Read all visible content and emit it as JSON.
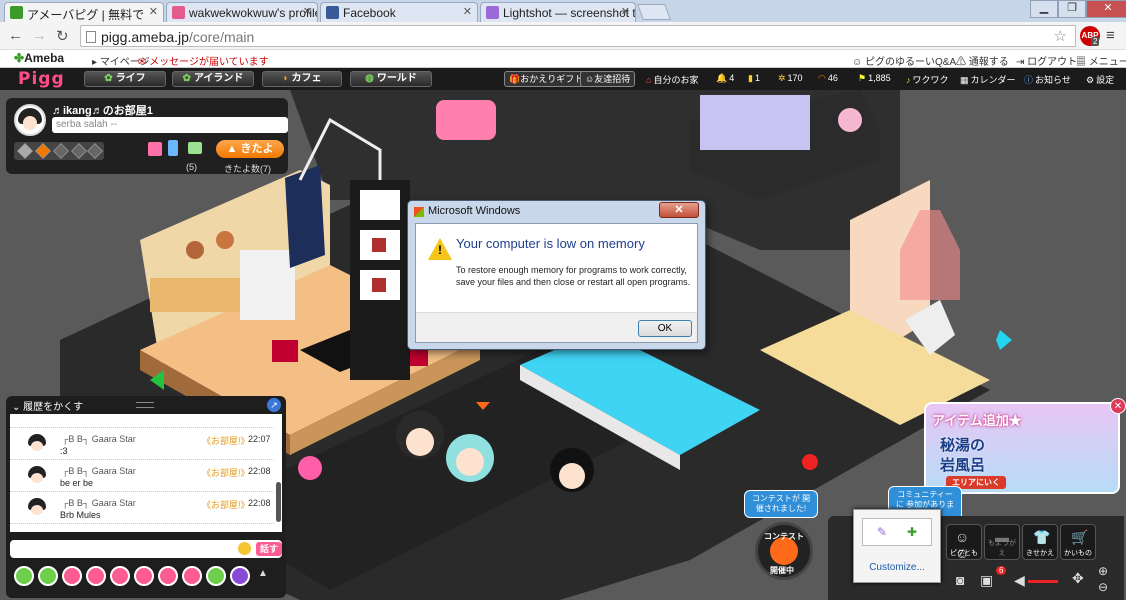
{
  "browser": {
    "tabs": [
      {
        "label": "アメーバピグ | 無料で",
        "favicon": "#3a9a2a"
      },
      {
        "label": "wakwekwokwuw's profile",
        "favicon": "#e55a8c"
      },
      {
        "label": "Facebook",
        "favicon": "#3b5998"
      },
      {
        "label": "Lightshot — screenshot to",
        "favicon": "#9c6ad8"
      }
    ],
    "url_host": "pigg.ameba.jp",
    "url_path": "/core/main",
    "abp_badge": "ABP",
    "abp_count": "2"
  },
  "ameba_bar": {
    "logo": "Ameba",
    "mypage": "マイページ",
    "messages": "メッセージが届いています",
    "help": "ピグのゆるーいQ&A",
    "report": "通報する",
    "logout": "ログアウト",
    "menu": "メニュー"
  },
  "pigg_header": {
    "logo": "Pigg",
    "nav": [
      "ライフ",
      "アイランド",
      "カフェ",
      "ワールド"
    ],
    "welcome_gift": "おかえりギフト",
    "invite": "友達招待",
    "home": "自分のお家",
    "bell_count": "4",
    "ticket_count": "1",
    "coin_count": "170",
    "rainbow_count": "46",
    "flag_count": "1,885",
    "wakuwaku": "ワクワク",
    "calendar": "カレンダー",
    "notice": "お知らせ",
    "settings": "設定"
  },
  "room_panel": {
    "title": "♬ikang♬のお部屋1",
    "status_placeholder": "serba salah --",
    "gift_count": "(5)",
    "kitayo_label": "きたよ",
    "kitayo_count": "きたよ数(7)"
  },
  "chat": {
    "hide_label": "履歴をかくす",
    "messages": [
      {
        "name": "┌B B┐ Gaara Star",
        "room": "《お部屋!》",
        "time": "22:07",
        "text": ":3"
      },
      {
        "name": "┌B B┐ Gaara Star",
        "room": "《お部屋!》",
        "time": "22:08",
        "text": "be er be"
      },
      {
        "name": "┌B B┐ Gaara Star",
        "room": "《お部屋!》",
        "time": "22:08",
        "text": "Brb Mules"
      }
    ],
    "say_label": "話す"
  },
  "dialog": {
    "title": "Microsoft Windows",
    "close_label": "✕",
    "heading": "Your computer is low on memory",
    "body": "To restore enough memory for programs to work correctly, save your files and then close or restart all open programs.",
    "ok_label": "OK"
  },
  "ad": {
    "line1": "アイテム追加★",
    "line2": "秘湯の",
    "line3": "岩風呂",
    "area_label": "エリアにいく"
  },
  "bubbles": {
    "contest_notice": "コンテストが 開催されました!",
    "community_notice": "コミュニティーに 参加がありました"
  },
  "contest": {
    "top": "コンテスト",
    "bottom": "開催中"
  },
  "dock": {
    "pigg_friends": "ピグとも",
    "moyougae": "もようがえ",
    "kisekae": "きせかえ",
    "kaimono": "かいもの",
    "customize": "Customize...",
    "notif_count": "6"
  }
}
